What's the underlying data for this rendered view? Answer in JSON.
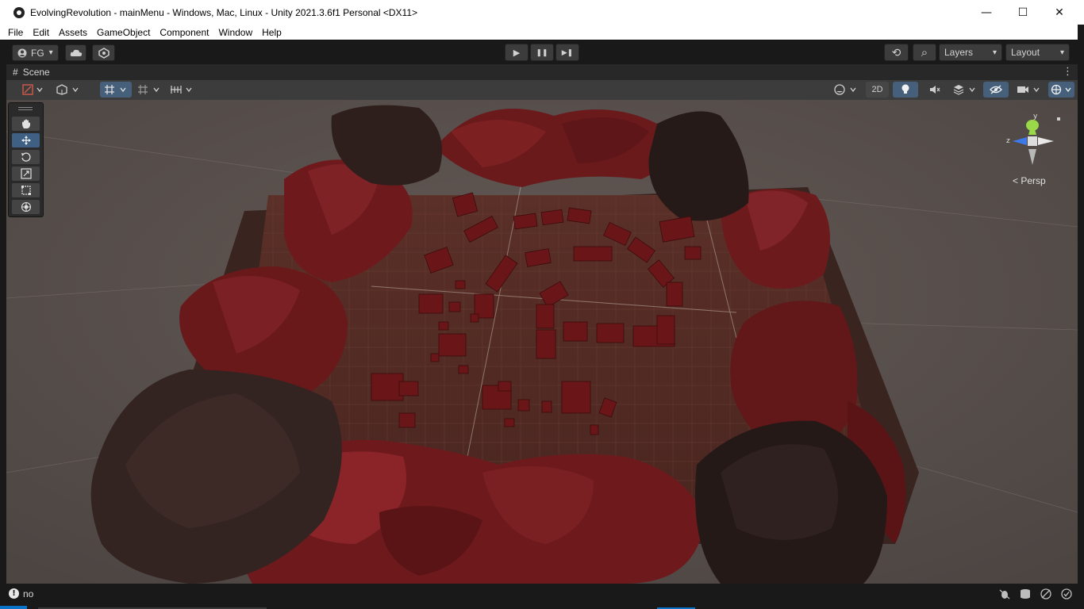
{
  "window": {
    "title": "EvolvingRevolution - mainMenu - Windows, Mac, Linux - Unity 2021.3.6f1 Personal <DX11>",
    "controls": {
      "minimize": "—",
      "maximize": "☐",
      "close": "✕"
    }
  },
  "menu": [
    "File",
    "Edit",
    "Assets",
    "GameObject",
    "Component",
    "Window",
    "Help"
  ],
  "toolbar": {
    "account_label": "FG",
    "account_caret": "▾",
    "play_icon": "▶",
    "pause_icon": "❚❚",
    "step_icon": "▶❚",
    "history_icon": "⟲",
    "search_icon": "⌕",
    "layers_label": "Layers",
    "layout_label": "Layout",
    "caret": "▾"
  },
  "tab": {
    "icon": "#",
    "label": "Scene",
    "menu_icon": "⋮"
  },
  "scene_toolbar": {
    "two_d_label": "2D"
  },
  "gizmo": {
    "y_label": "y",
    "z_label": "z",
    "persp_label": "< Persp"
  },
  "status": {
    "icon": "!",
    "message": "no"
  },
  "colors": {
    "accent": "#3f5f83",
    "terrain_red": "#6e1a1c",
    "rock": "#2b1e1c",
    "ground": "#574a44"
  }
}
